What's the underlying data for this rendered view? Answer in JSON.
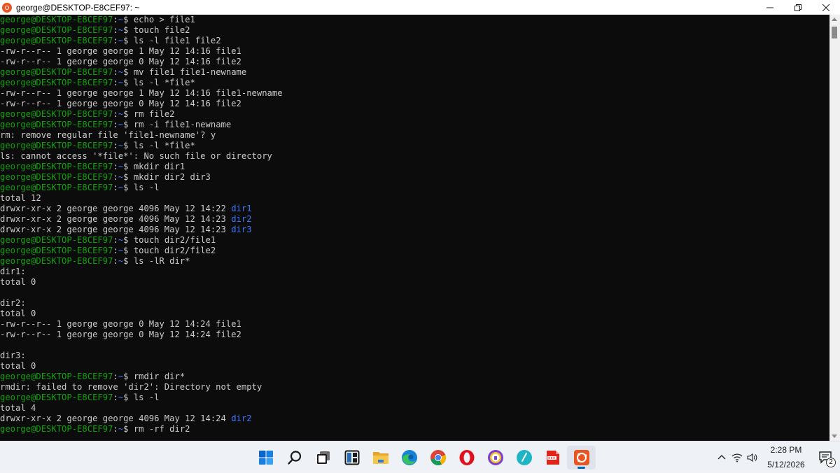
{
  "window": {
    "title": "george@DESKTOP-E8CEF97: ~",
    "controls": [
      "minimize-icon",
      "restore-icon",
      "close-icon"
    ]
  },
  "terminal": {
    "colors": {
      "background": "#0c0c0c",
      "text": "#cccccc",
      "prompt_user": "#13a10e",
      "prompt_path": "#3b78ff",
      "directory": "#3b78ff"
    },
    "prompt": {
      "user": "george@DESKTOP-E8CEF97",
      "sep": ":",
      "path": "~",
      "symbol": "$ "
    },
    "lines": [
      {
        "t": "cmd",
        "text": "echo > file1"
      },
      {
        "t": "cmd",
        "text": "touch file2"
      },
      {
        "t": "cmd",
        "text": "ls -l file1 file2"
      },
      {
        "t": "out",
        "text": "-rw-r--r-- 1 george george 1 May 12 14:16 file1"
      },
      {
        "t": "out",
        "text": "-rw-r--r-- 1 george george 0 May 12 14:16 file2"
      },
      {
        "t": "cmd",
        "text": "mv file1 file1-newname"
      },
      {
        "t": "cmd",
        "text": "ls -l *file*"
      },
      {
        "t": "out",
        "text": "-rw-r--r-- 1 george george 1 May 12 14:16 file1-newname"
      },
      {
        "t": "out",
        "text": "-rw-r--r-- 1 george george 0 May 12 14:16 file2"
      },
      {
        "t": "cmd",
        "text": "rm file2"
      },
      {
        "t": "cmd",
        "text": "rm -i file1-newname"
      },
      {
        "t": "out",
        "text": "rm: remove regular file 'file1-newname'? y"
      },
      {
        "t": "cmd",
        "text": "ls -l *file*"
      },
      {
        "t": "out",
        "text": "ls: cannot access '*file*': No such file or directory"
      },
      {
        "t": "cmd",
        "text": "mkdir dir1"
      },
      {
        "t": "cmd",
        "text": "mkdir dir2 dir3"
      },
      {
        "t": "cmd",
        "text": "ls -l"
      },
      {
        "t": "out",
        "text": "total 12"
      },
      {
        "t": "dir",
        "text": "drwxr-xr-x 2 george george 4096 May 12 14:22 ",
        "name": "dir1"
      },
      {
        "t": "dir",
        "text": "drwxr-xr-x 2 george george 4096 May 12 14:23 ",
        "name": "dir2"
      },
      {
        "t": "dir",
        "text": "drwxr-xr-x 2 george george 4096 May 12 14:23 ",
        "name": "dir3"
      },
      {
        "t": "cmd",
        "text": "touch dir2/file1"
      },
      {
        "t": "cmd",
        "text": "touch dir2/file2"
      },
      {
        "t": "cmd",
        "text": "ls -lR dir*"
      },
      {
        "t": "out",
        "text": "dir1:"
      },
      {
        "t": "out",
        "text": "total 0"
      },
      {
        "t": "out",
        "text": ""
      },
      {
        "t": "out",
        "text": "dir2:"
      },
      {
        "t": "out",
        "text": "total 0"
      },
      {
        "t": "out",
        "text": "-rw-r--r-- 1 george george 0 May 12 14:24 file1"
      },
      {
        "t": "out",
        "text": "-rw-r--r-- 1 george george 0 May 12 14:24 file2"
      },
      {
        "t": "out",
        "text": ""
      },
      {
        "t": "out",
        "text": "dir3:"
      },
      {
        "t": "out",
        "text": "total 0"
      },
      {
        "t": "cmd",
        "text": "rmdir dir*"
      },
      {
        "t": "out",
        "text": "rmdir: failed to remove 'dir2': Directory not empty"
      },
      {
        "t": "cmd",
        "text": "ls -l"
      },
      {
        "t": "out",
        "text": "total 4"
      },
      {
        "t": "dir",
        "text": "drwxr-xr-x 2 george george 4096 May 12 14:24 ",
        "name": "dir2"
      },
      {
        "t": "cmd",
        "text": "rm -rf dir2"
      }
    ]
  },
  "taskbar": {
    "apps": [
      {
        "name": "windows-start-icon"
      },
      {
        "name": "search-icon"
      },
      {
        "name": "task-view-icon"
      },
      {
        "name": "widgets-icon"
      },
      {
        "name": "file-explorer-icon"
      },
      {
        "name": "edge-icon"
      },
      {
        "name": "chrome-icon"
      },
      {
        "name": "opera-icon"
      },
      {
        "name": "vpn-shield-icon"
      },
      {
        "name": "notes-app-icon"
      },
      {
        "name": "pdf-icon"
      },
      {
        "name": "ubuntu-icon",
        "active": true
      }
    ],
    "tray": {
      "icons": [
        "chevron-up-icon",
        "wifi-icon",
        "speaker-icon"
      ],
      "time": "2:28 PM",
      "date": "5/12/2026",
      "notification_count": "2"
    }
  }
}
